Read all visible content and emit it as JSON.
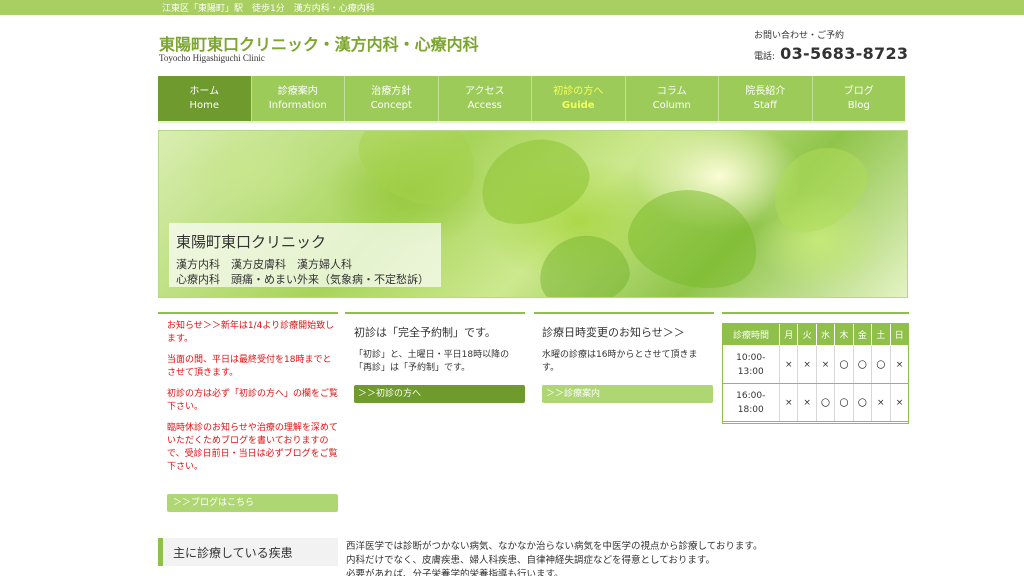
{
  "topbar": {
    "text": "江東区「東陽町」駅　徒歩1分　漢方内科・心療内科"
  },
  "header": {
    "title": "東陽町東口クリニック・漢方内科・心療内科",
    "subtitle": "Toyocho Higashiguchi Clinic",
    "contact_label": "お問い合わせ・ご予約",
    "phone_label": "電話:",
    "phone_number": "03-5683-8723"
  },
  "nav": [
    {
      "jp": "ホーム",
      "en": "Home",
      "active": true
    },
    {
      "jp": "診療案内",
      "en": "Information"
    },
    {
      "jp": "治療方針",
      "en": "Concept"
    },
    {
      "jp": "アクセス",
      "en": "Access"
    },
    {
      "jp": "初診の方へ",
      "en": "Guide",
      "highlight": true
    },
    {
      "jp": "コラム",
      "en": "Column"
    },
    {
      "jp": "院長紹介",
      "en": "Staff"
    },
    {
      "jp": "ブログ",
      "en": "Blog"
    }
  ],
  "hero": {
    "title": "東陽町東口クリニック",
    "line1": "漢方内科　漢方皮膚科　漢方婦人科",
    "line2": "心療内科　頭痛・めまい外来（気象病・不定愁訴）"
  },
  "notices": {
    "items": [
      "お知らせ＞＞新年は1/4より診療開始致します。",
      "当面の間、平日は最終受付を18時までとさせて頂きます。",
      "初診の方は必ず「初診の方へ」の欄をご覧下さい。",
      "臨時休診のお知らせや治療の理解を深めていただくためブログを書いておりますので、受診日前日・当日は必ずブログをご覧下さい。"
    ],
    "button": "＞＞ブログはこちら"
  },
  "first_visit": {
    "title": "初診は「完全予約制」です。",
    "line1": "「初診」と、土曜日・平日18時以降の",
    "line2": "「再診」は「予約制」です。",
    "button": "＞＞初診の方へ"
  },
  "schedule_change": {
    "title": "診療日時変更のお知らせ＞＞",
    "line1": "水曜の診療は16時からとさせて頂きま",
    "line2": "す。",
    "button": "＞＞診療案内"
  },
  "schedule": {
    "headers": [
      "診療時間",
      "月",
      "火",
      "水",
      "木",
      "金",
      "土",
      "日"
    ],
    "rows": [
      {
        "time_a": "10:00-",
        "time_b": "13:00",
        "cells": [
          "×",
          "×",
          "×",
          "〇",
          "〇",
          "〇",
          "×"
        ]
      },
      {
        "time_a": "16:00-",
        "time_b": "18:00",
        "cells": [
          "×",
          "×",
          "〇",
          "〇",
          "〇",
          "×",
          "×"
        ]
      }
    ]
  },
  "main_section": {
    "title": "主に診療している疾患",
    "intro": [
      "西洋医学では診断がつかない病気、なかなか治らない病気を中医学の視点から診療しております。",
      "内科だけでなく、皮膚疾患、婦人科疾患、自律神経失調症などを得意としております。",
      "必要があれば、分子栄養学的栄養指導も行います。"
    ]
  },
  "colors": {
    "accent": "#9ccb5a",
    "accent_dark": "#6f9a2d",
    "title_green": "#7ca62f",
    "notice_red": "#e01010"
  }
}
